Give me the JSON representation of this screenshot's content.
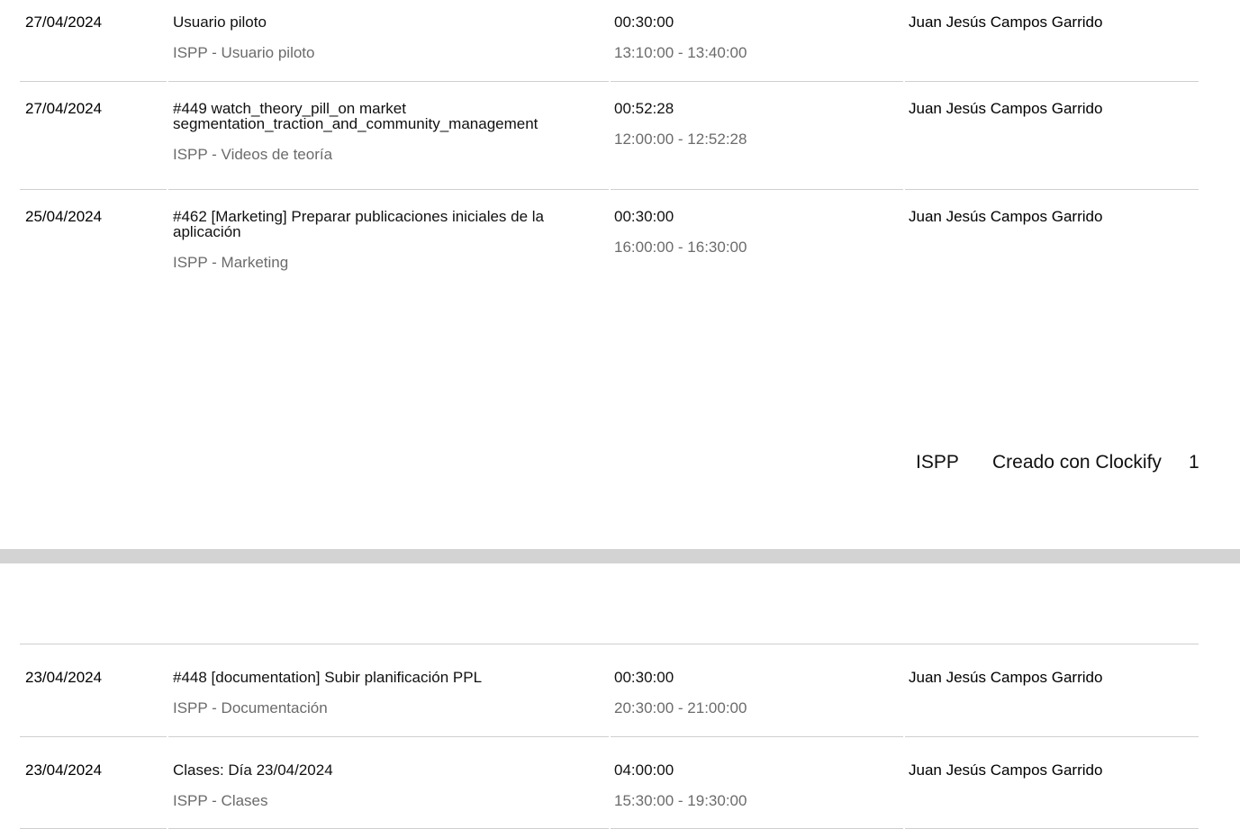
{
  "page1": {
    "entries": [
      {
        "date": "27/04/2024",
        "description": "Usuario piloto",
        "project": "ISPP - Usuario piloto",
        "duration": "00:30:00",
        "range": "13:10:00 - 13:40:00",
        "user": "Juan Jesús Campos Garrido"
      },
      {
        "date": "27/04/2024",
        "description": "#449 watch_theory_pill_on market segmentation_traction_and_community_management",
        "project": "ISPP - Videos de teoría",
        "duration": "00:52:28",
        "range": "12:00:00 - 12:52:28",
        "user": "Juan Jesús Campos Garrido"
      },
      {
        "date": "25/04/2024",
        "description": "#462 [Marketing] Preparar publicaciones iniciales de la aplicación",
        "project": "ISPP - Marketing",
        "duration": "00:30:00",
        "range": "16:00:00 - 16:30:00",
        "user": "Juan Jesús Campos Garrido"
      }
    ],
    "footer": {
      "workspace": "ISPP",
      "created_with": "Creado con Clockify",
      "page_number": "1"
    }
  },
  "page2": {
    "entries": [
      {
        "date": "23/04/2024",
        "description": "#448 [documentation] Subir planificación PPL",
        "project": "ISPP - Documentación",
        "duration": "00:30:00",
        "range": "20:30:00 - 21:00:00",
        "user": "Juan Jesús Campos Garrido"
      },
      {
        "date": "23/04/2024",
        "description": "Clases: Día 23/04/2024",
        "project": "ISPP - Clases",
        "duration": "04:00:00",
        "range": "15:30:00 - 19:30:00",
        "user": "Juan Jesús Campos Garrido"
      }
    ]
  }
}
